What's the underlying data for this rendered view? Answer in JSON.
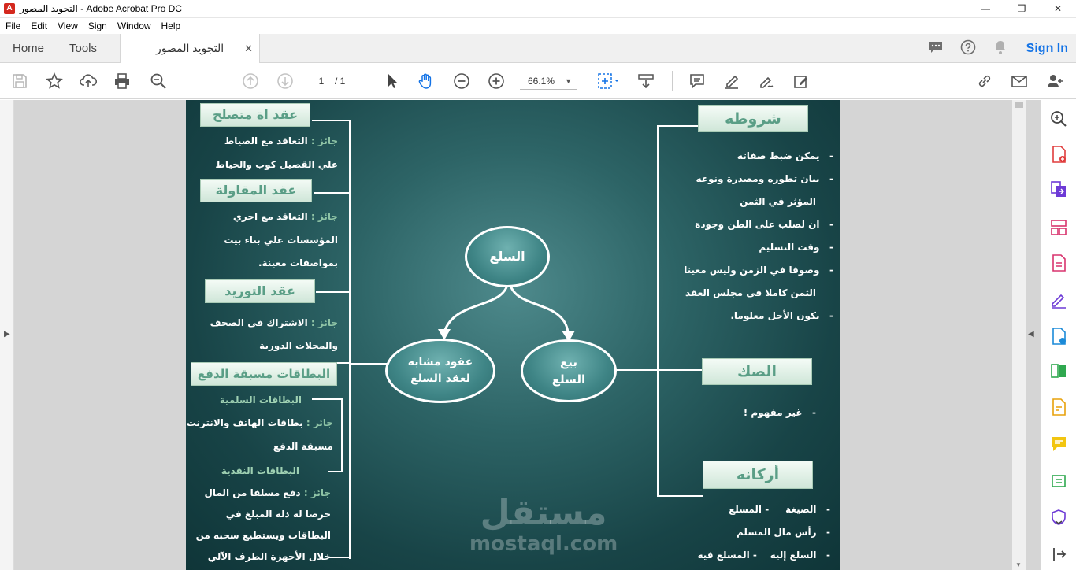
{
  "window": {
    "title": "التجويد المصور - Adobe Acrobat Pro DC",
    "controls": {
      "minimize": "—",
      "restore": "❐",
      "close": "✕"
    }
  },
  "menu": [
    "File",
    "Edit",
    "View",
    "Sign",
    "Window",
    "Help"
  ],
  "tabs": {
    "home": "Home",
    "tools": "Tools",
    "document": "التجويد المصور",
    "close": "✕"
  },
  "header": {
    "sign_in": "Sign In"
  },
  "toolbar": {
    "page_current": "1",
    "page_total": "/ 1",
    "zoom": "66.1%",
    "zoom_arrow": "▼"
  },
  "workarea": {
    "left_arrow": "▶",
    "right_arrow": "◀",
    "scroll_down": "▼"
  },
  "document": {
    "left": {
      "box1": "عقد اة متصلح",
      "box1_p1_prefix": "جائز : ",
      "box1_p1": "التعاقد مع الصياط",
      "box1_p2": "علي القصيل كوب والخياط",
      "box2": "عقد المقاولة",
      "box2_p1_prefix": "جائز : ",
      "box2_p1": "التعاقد مع احري",
      "box2_p2": "المؤسسات علي بناء بيت",
      "box2_p3": "بمواصفات معينة.",
      "box3": "عقد التوريد",
      "box3_p1_prefix": "جائز : ",
      "box3_p1": "الاشتراك في الصحف",
      "box3_p2": "والمجلات الدورية",
      "box4": "البطاقات مسبقة الدفع",
      "sub1": "البطاقات السلمية",
      "sub1_p1_prefix": "جائز : ",
      "sub1_p1": "بطاقات الهاتف والانترنت",
      "sub1_p2": "مسبقة الدفع",
      "sub2": "البطاقات النقدية",
      "sub2_p1_prefix": "جائز : ",
      "sub2_p1": "دفع مسلفا من المال",
      "sub2_p2": "حرصا له ذله المبلغ في",
      "sub2_p3": "البطاقات ويستطيع سحبه من",
      "sub2_p4": "خلال الأجهزة الطرف الآلي"
    },
    "center": {
      "root": "السلع",
      "left_node": "عقود مشابه لعقد السلع",
      "right_node": "بيع السلع"
    },
    "right": {
      "box1": "شروطه",
      "items1": [
        "يمكن ضبط صفاته",
        "بيان تطوره ومصدرة ونوعه",
        "المؤثر في الثمن",
        "ان لصلب على الطن وجودة",
        "وقت التسليم",
        "وصوفا في الزمن وليس معينا",
        "الثمن كاملا في مجلس العقد",
        "يكون الأجل معلوما."
      ],
      "box2": "الصك",
      "item2": "غير مفهوم !",
      "box3": "أركانه",
      "items3": [
        "الصيغة     - المسلع",
        "رأس مال المسلم",
        "السلع إليه    - المسلع فيه"
      ]
    },
    "watermark": {
      "line1": "مستقل",
      "line2": "mostaql.com"
    }
  }
}
